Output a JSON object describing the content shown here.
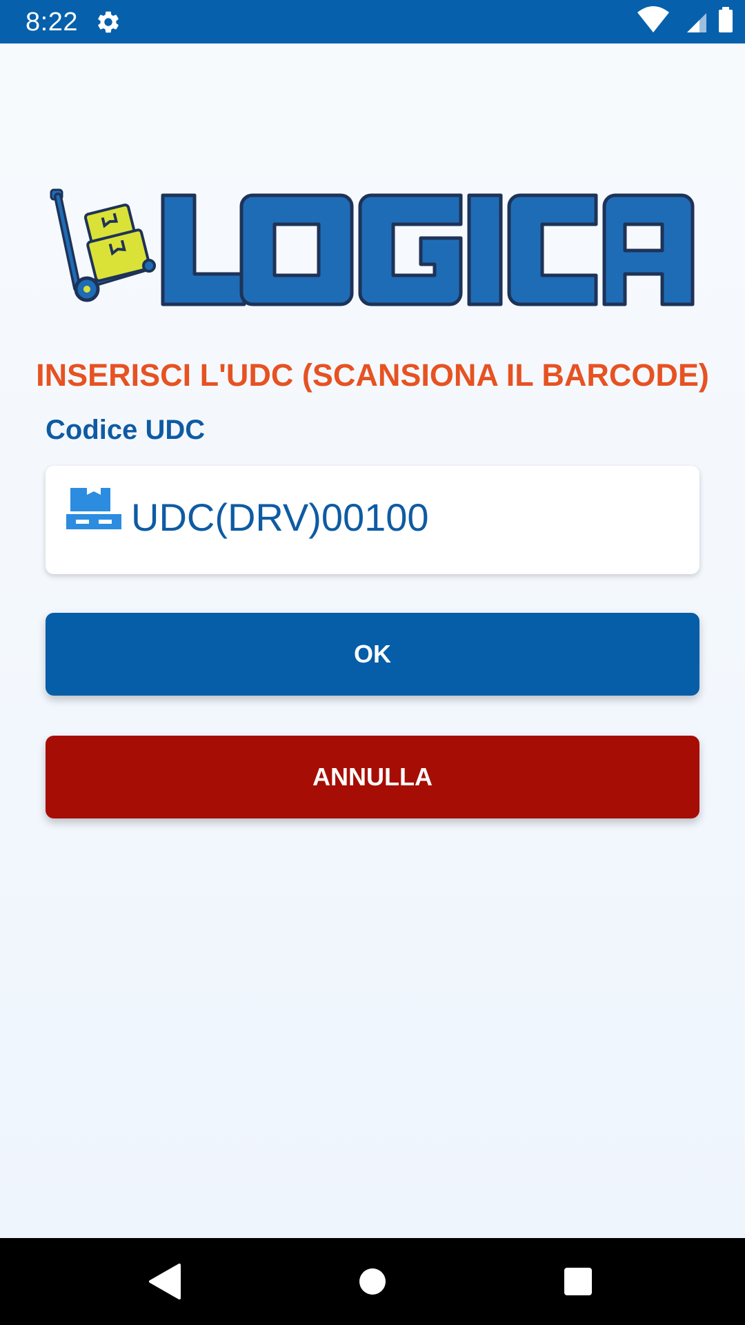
{
  "status_bar": {
    "time": "8:22",
    "settings_icon": "gear-icon",
    "wifi_icon": "wifi-icon",
    "signal_icon": "cellular-signal-icon",
    "battery_icon": "battery-icon"
  },
  "logo": {
    "text": "LOGICA",
    "icon": "hand-truck-boxes-icon"
  },
  "form": {
    "instruction": "INSERISCI L'UDC (SCANSIONA IL BARCODE)",
    "field_label": "Codice UDC",
    "field_icon": "pallet-icon",
    "udc_value": "UDC(DRV)00100"
  },
  "buttons": {
    "ok_label": "OK",
    "cancel_label": "ANNULLA"
  },
  "nav_bar": {
    "back_icon": "back-icon",
    "home_icon": "home-icon",
    "recents_icon": "recents-icon"
  },
  "colors": {
    "status_bar": "#0760ab",
    "instruction": "#e65222",
    "primary": "#065da8",
    "danger": "#a60e05",
    "logo_blue": "#1f6cb6",
    "logo_outline": "#1e3358",
    "box_yellow": "#dbe237"
  }
}
